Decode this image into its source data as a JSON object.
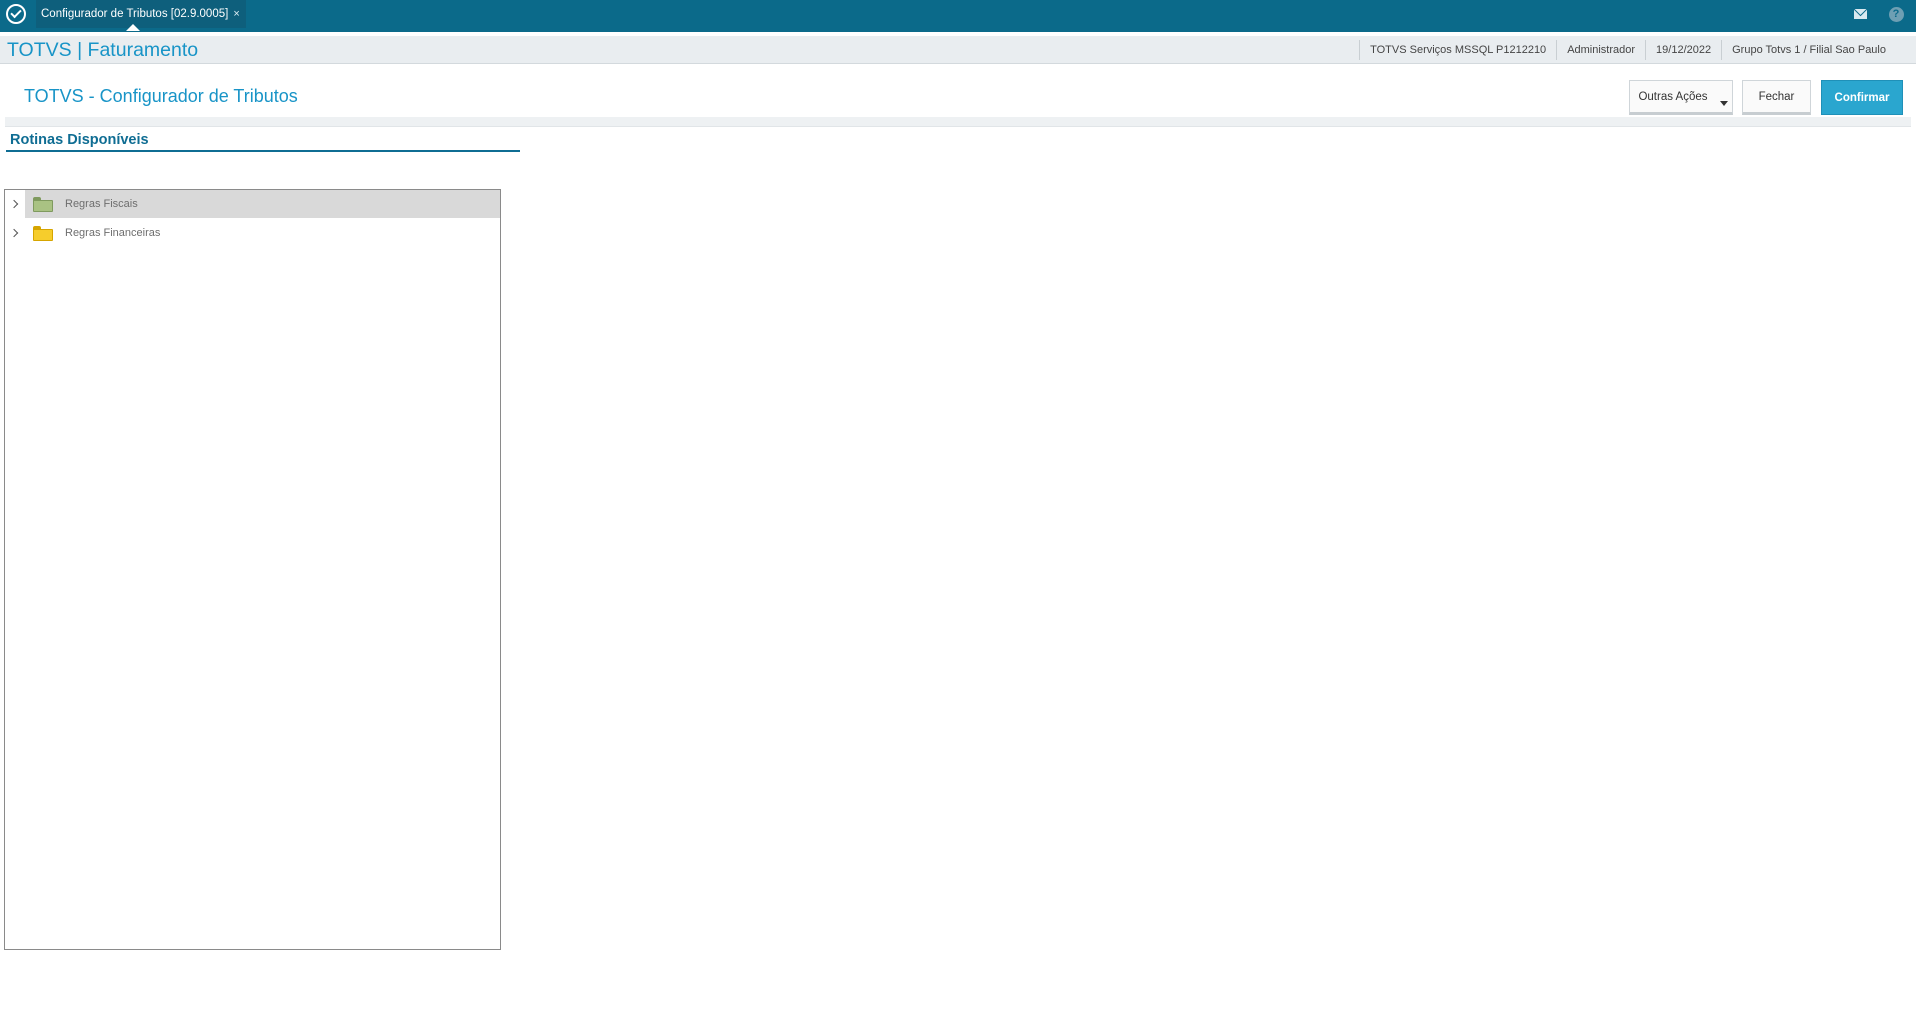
{
  "topbar": {
    "tab_label": "Configurador de Tributos [02.9.0005]",
    "tab_close": "×",
    "help_glyph": "?",
    "icons": [
      "app-logo-icon",
      "mail-icon",
      "help-icon"
    ]
  },
  "header": {
    "title": "TOTVS | Faturamento",
    "environment": "TOTVS Serviços MSSQL P1212210",
    "user": "Administrador",
    "date": "19/12/2022",
    "company": "Grupo Totvs 1 / Filial Sao Paulo"
  },
  "page": {
    "title": "TOTVS - Configurador de Tributos",
    "buttons": {
      "outras_acoes": "Outras Ações",
      "fechar": "Fechar",
      "confirmar": "Confirmar"
    }
  },
  "section": {
    "title": "Rotinas Disponíveis"
  },
  "tree": {
    "items": [
      {
        "label": "Regras Fiscais",
        "icon": "folder-green-icon",
        "selected": true
      },
      {
        "label": "Regras Financeiras",
        "icon": "folder-yellow-icon",
        "selected": false
      }
    ]
  },
  "colors": {
    "topbar": "#0b6a8a",
    "accent": "#1894c7",
    "confirm_button": "#2aa6cf",
    "section_title": "#0f6d93"
  }
}
